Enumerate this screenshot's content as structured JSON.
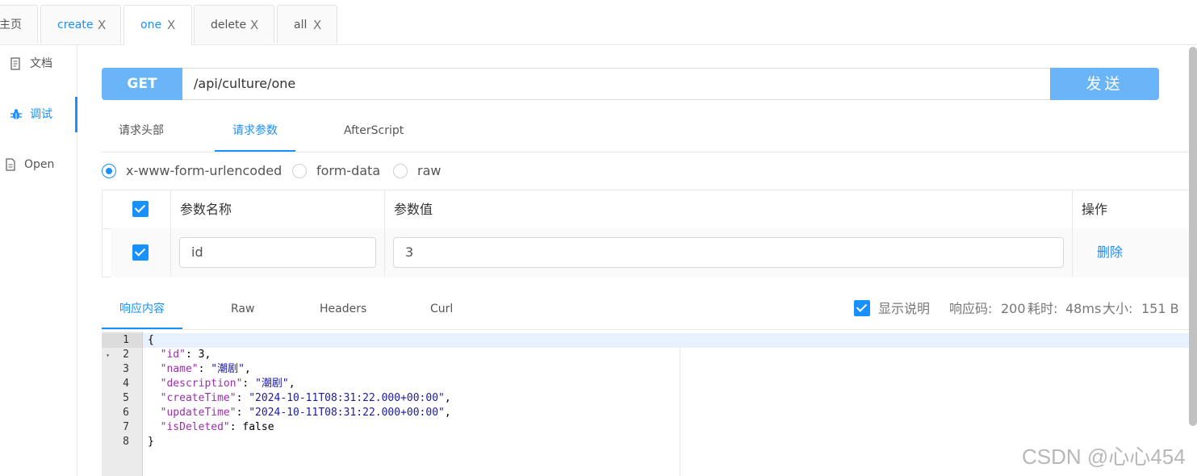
{
  "tabs": [
    {
      "label": "主页",
      "closable": false
    },
    {
      "label": "create",
      "close": "X"
    },
    {
      "label": "one",
      "close": "X"
    },
    {
      "label": "delete",
      "close": "X"
    },
    {
      "label": "all",
      "close": "X"
    }
  ],
  "sidebar": {
    "items": [
      {
        "label": "文档",
        "icon": "document-icon"
      },
      {
        "label": "调试",
        "icon": "bug-icon"
      },
      {
        "label": "Open",
        "icon": "file-icon"
      }
    ]
  },
  "request": {
    "method": "GET",
    "url": "/api/culture/one",
    "send_label": "发送"
  },
  "subtabs": [
    "请求头部",
    "请求参数",
    "AfterScript"
  ],
  "body_types": [
    "x-www-form-urlencoded",
    "form-data",
    "raw"
  ],
  "params_table": {
    "headers": [
      "参数名称",
      "参数值",
      "操作"
    ],
    "rows": [
      {
        "name": "id",
        "value": "3",
        "action": "删除"
      }
    ]
  },
  "response_tabs": [
    "响应内容",
    "Raw",
    "Headers",
    "Curl"
  ],
  "response_info": {
    "show_desc_label": "显示说明",
    "code_label": "响应码:",
    "code": "200",
    "time_label": "耗时:",
    "time": "48ms",
    "size_label": "大小:",
    "size": "151 B"
  },
  "code_lines": [
    {
      "n": "1",
      "text": "{"
    },
    {
      "n": "2",
      "key": "\"id\"",
      "sep": ": ",
      "val": "3,",
      "type": "plain"
    },
    {
      "n": "3",
      "key": "\"name\"",
      "sep": ": ",
      "val": "\"潮剧\"",
      "tail": ",",
      "type": "str"
    },
    {
      "n": "4",
      "key": "\"description\"",
      "sep": ": ",
      "val": "\"潮剧\"",
      "tail": ",",
      "type": "str"
    },
    {
      "n": "5",
      "key": "\"createTime\"",
      "sep": ": ",
      "val": "\"2024-10-11T08:31:22.000+00:00\"",
      "tail": ",",
      "type": "str"
    },
    {
      "n": "6",
      "key": "\"updateTime\"",
      "sep": ": ",
      "val": "\"2024-10-11T08:31:22.000+00:00\"",
      "tail": ",",
      "type": "str"
    },
    {
      "n": "7",
      "key": "\"isDeleted\"",
      "sep": ": ",
      "val": "false",
      "type": "plain"
    },
    {
      "n": "8",
      "text": "}"
    }
  ],
  "watermark": "CSDN @心心454",
  "colors": {
    "accent": "#1890ff",
    "method_bg": "#69b5f8",
    "status_green": "#41b883"
  }
}
